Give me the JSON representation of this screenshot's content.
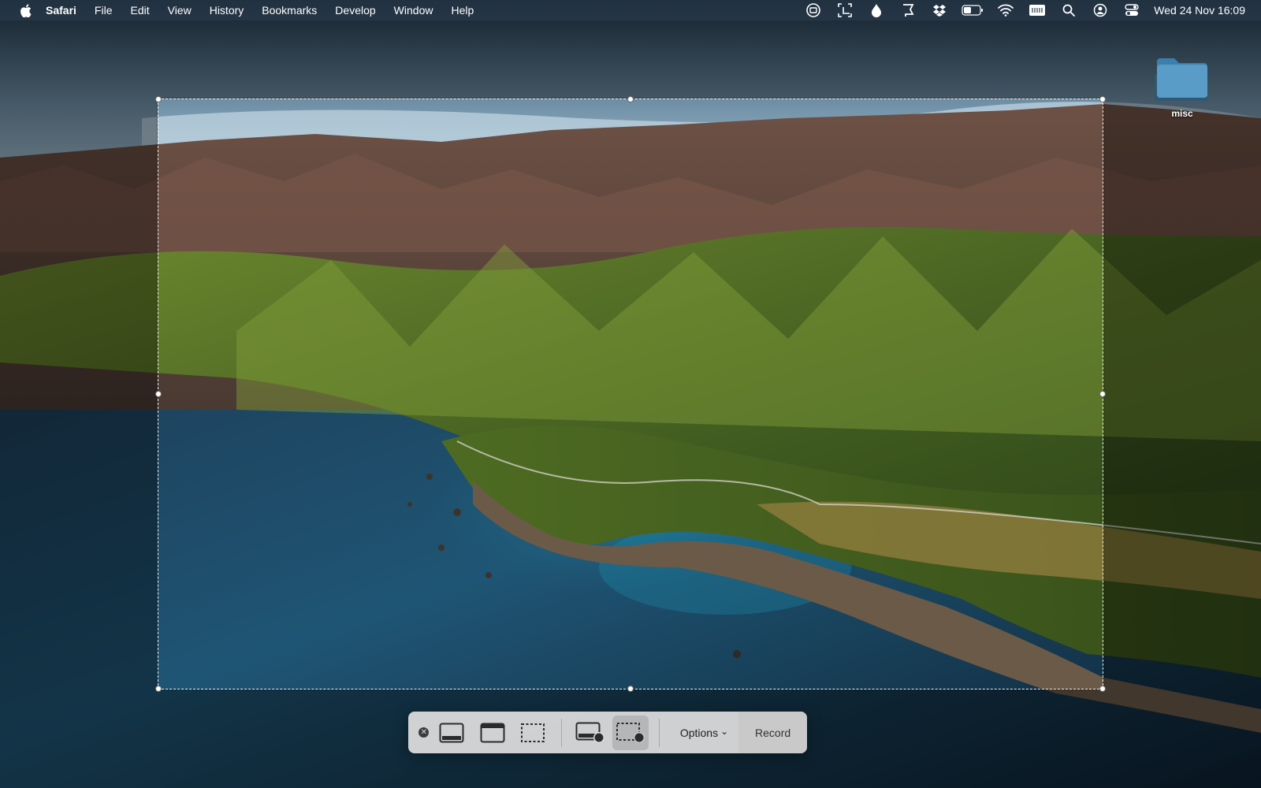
{
  "menubar": {
    "apple": "apple-logo",
    "app_name": "Safari",
    "menus": [
      "File",
      "Edit",
      "View",
      "History",
      "Bookmarks",
      "Develop",
      "Window",
      "Help"
    ],
    "status_icons": [
      "screen-mirroring-icon",
      "screenshot-crop-icon",
      "drop-icon",
      "flag-tag-icon",
      "dropbox-icon",
      "battery-icon",
      "wifi-icon",
      "keyboard-input-icon",
      "spotlight-search-icon",
      "user-account-icon",
      "control-center-icon"
    ],
    "clock": "Wed 24 Nov  16:09"
  },
  "desktop": {
    "folder_label": "misc",
    "folder_icon": "folder-icon"
  },
  "toolbar": {
    "close_glyph": "✕",
    "tools": [
      {
        "name": "capture-entire-screen",
        "icon": "entire-screen-icon"
      },
      {
        "name": "capture-selected-window",
        "icon": "window-icon"
      },
      {
        "name": "capture-selected-portion",
        "icon": "selection-icon"
      },
      {
        "name": "record-entire-screen",
        "icon": "record-screen-icon"
      },
      {
        "name": "record-selected-portion",
        "icon": "record-selection-icon",
        "selected": true
      }
    ],
    "options_label": "Options",
    "options_chevron": "⌄",
    "record_label": "Record"
  },
  "colors": {
    "menubar_bg": "#2c3e50",
    "toolbar_bg": "#dedede",
    "record_bg": "#c9c9c9",
    "folder_blue": "#4e8fb9"
  }
}
